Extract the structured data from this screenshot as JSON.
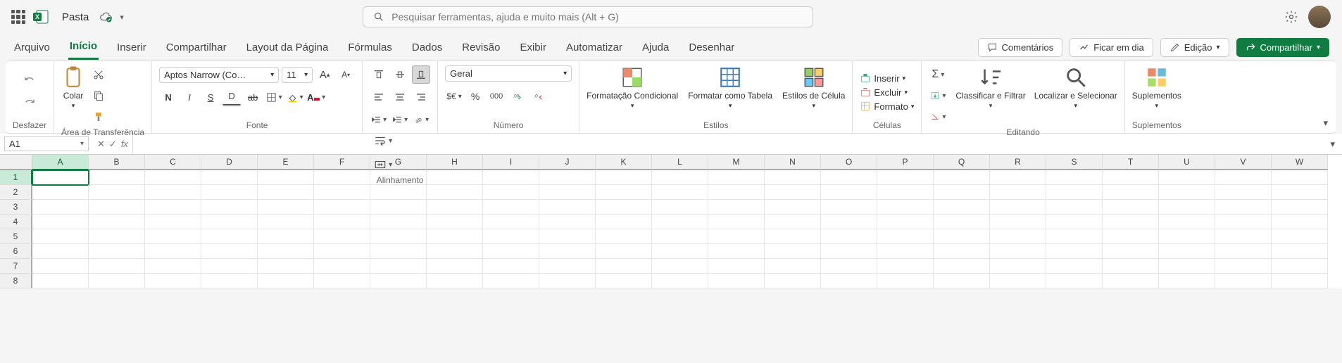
{
  "titlebar": {
    "doc_name": "Pasta",
    "search_placeholder": "Pesquisar ferramentas, ajuda e muito mais (Alt + G)"
  },
  "tabs": {
    "items": [
      "Arquivo",
      "Início",
      "Inserir",
      "Compartilhar",
      "Layout da Página",
      "Fórmulas",
      "Dados",
      "Revisão",
      "Exibir",
      "Automatizar",
      "Ajuda",
      "Desenhar"
    ],
    "active_index": 1,
    "comments": "Comentários",
    "catchup": "Ficar em dia",
    "editing": "Edição",
    "share": "Compartilhar"
  },
  "ribbon": {
    "undo_group": "Desfazer",
    "clipboard": {
      "paste": "Colar",
      "group": "Área de Transferência"
    },
    "font": {
      "name": "Aptos Narrow (Co…",
      "size": "11",
      "group": "Fonte"
    },
    "alignment": {
      "group": "Alinhamento"
    },
    "number": {
      "format": "Geral",
      "group": "Número"
    },
    "styles": {
      "cond": "Formatação Condicional",
      "table": "Formatar como Tabela",
      "cell": "Estilos de Célula",
      "group": "Estilos"
    },
    "cells": {
      "insert": "Inserir",
      "delete": "Excluir",
      "format": "Formato",
      "group": "Células"
    },
    "editing": {
      "sort": "Classificar e Filtrar",
      "find": "Localizar e Selecionar",
      "group": "Editando"
    },
    "addins": {
      "label": "Suplementos",
      "group": "Suplementos"
    }
  },
  "formula_bar": {
    "cell_ref": "A1",
    "formula": ""
  },
  "grid": {
    "columns": [
      "A",
      "B",
      "C",
      "D",
      "E",
      "F",
      "G",
      "H",
      "I",
      "J",
      "K",
      "L",
      "M",
      "N",
      "O",
      "P",
      "Q",
      "R",
      "S",
      "T",
      "U",
      "V",
      "W"
    ],
    "rows": [
      1,
      2,
      3,
      4,
      5,
      6,
      7,
      8
    ],
    "selected": {
      "row": 1,
      "col": 0
    }
  }
}
